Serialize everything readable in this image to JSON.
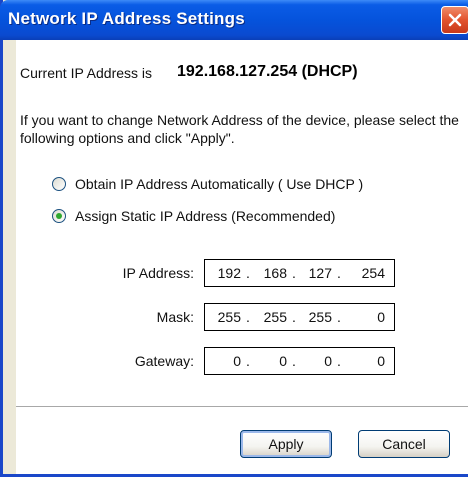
{
  "window": {
    "title": "Network IP Address Settings"
  },
  "current": {
    "label": "Current IP Address is",
    "value": "192.168.127.254 (DHCP)"
  },
  "info_text": "If you want to change Network Address of the device, please select the following options and click \"Apply\".",
  "options": [
    {
      "label": "Obtain IP Address Automatically ( Use DHCP )",
      "checked": false
    },
    {
      "label": "Assign Static IP Address  (Recommended)",
      "checked": true
    }
  ],
  "fields": {
    "ip": {
      "label": "IP Address:",
      "octets": [
        "192",
        "168",
        "127",
        "254"
      ]
    },
    "mask": {
      "label": "Mask:",
      "octets": [
        "255",
        "255",
        "255",
        "0"
      ]
    },
    "gateway": {
      "label": "Gateway:",
      "octets": [
        "0",
        "0",
        "0",
        "0"
      ]
    }
  },
  "buttons": {
    "apply": "Apply",
    "cancel": "Cancel"
  },
  "colors": {
    "titlebar": "#0553dc",
    "close": "#e2532e",
    "radio_selected": "#2fa82f"
  },
  "icons": {
    "close": "close-icon"
  }
}
